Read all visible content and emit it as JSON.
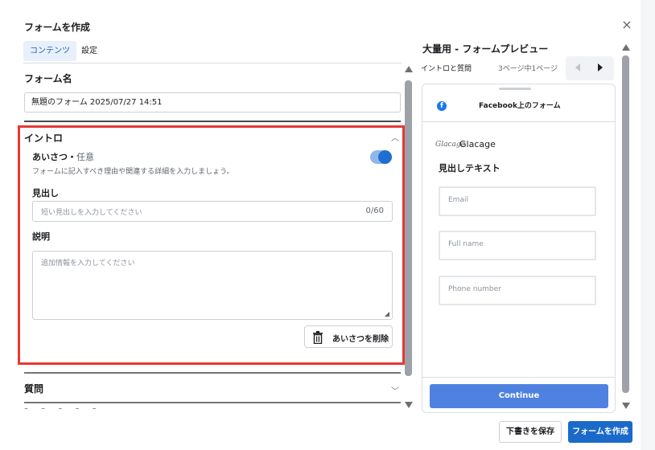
{
  "dialog": {
    "title": "フォームを作成",
    "close_icon": "×"
  },
  "tabs": [
    {
      "label": "コンテンツ",
      "active": true
    },
    {
      "label": "設定",
      "active": false
    }
  ],
  "form_name": {
    "title": "フォーム名",
    "value": "無題のフォーム 2025/07/27 14:51"
  },
  "intro": {
    "title": "イントロ",
    "greeting": {
      "label": "あいさつ・",
      "optional": "任意",
      "description": "フォームに記入すべき理由や関連する詳細を入力しましょう。",
      "enabled": true
    },
    "headline": {
      "label": "見出し",
      "placeholder": "短い見出しを入力してください",
      "counter": "0/60"
    },
    "description": {
      "label": "説明",
      "placeholder": "追加情報を入力してください"
    },
    "delete_label": "あいさつを削除"
  },
  "questions": {
    "title": "質問"
  },
  "preview": {
    "title": "大量用 - フォームプレビュー",
    "section": "イントロと質問",
    "page_indicator": "3ページ中1ページ",
    "fb_icon": "f",
    "header": "Facebook上のフォーム",
    "brand_logo": "Glacage",
    "brand_name": "Glacage",
    "headline": "見出しテキスト",
    "fields": [
      "Email",
      "Full name",
      "Phone number"
    ],
    "continue_label": "Continue"
  },
  "footer": {
    "save_draft": "下書きを保存",
    "create": "フォームを作成"
  },
  "colors": {
    "accent": "#1b6ac9",
    "highlight": "#e53935",
    "continue": "#4f82e0"
  }
}
